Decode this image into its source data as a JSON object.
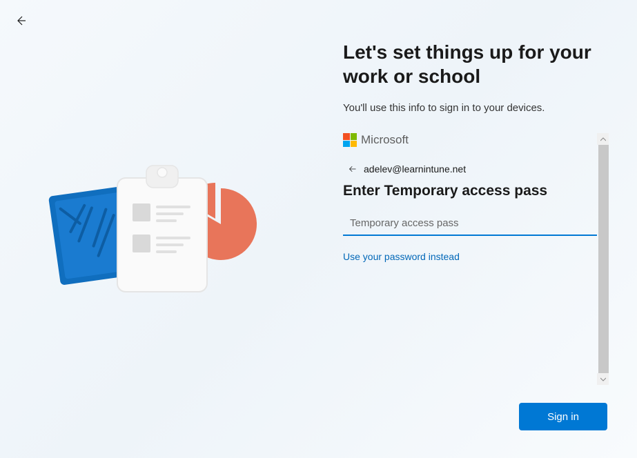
{
  "header": {
    "title": "Let's set things up for your work or school",
    "subtitle": "You'll use this info to sign in to your devices."
  },
  "auth": {
    "brand": "Microsoft",
    "account_email": "adelev@learnintune.net",
    "prompt_title": "Enter Temporary access pass",
    "input_placeholder": "Temporary access pass",
    "input_value": "",
    "alt_link": "Use your password instead"
  },
  "actions": {
    "signin_label": "Sign in"
  },
  "colors": {
    "accent": "#0078d4",
    "link": "#0067b8"
  }
}
